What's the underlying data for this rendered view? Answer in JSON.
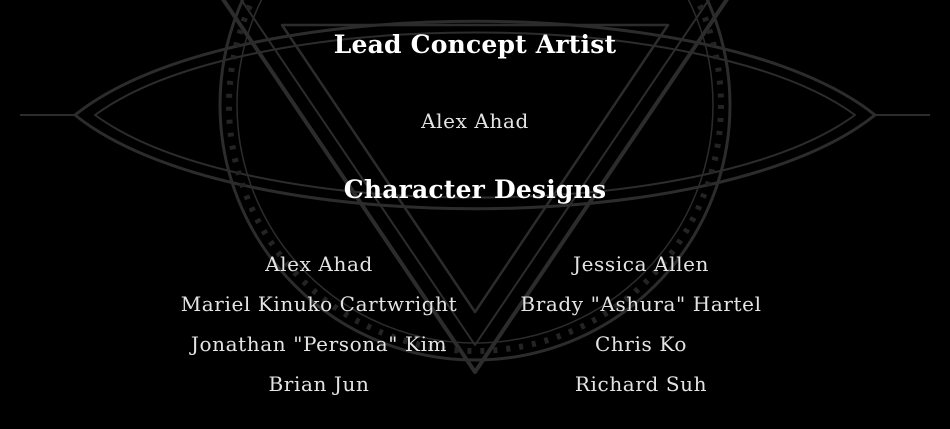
{
  "credits": {
    "lead_concept": {
      "title": "Lead Concept Artist",
      "names": [
        "Alex Ahad"
      ]
    },
    "character_designs": {
      "title": "Character Designs",
      "left_column": [
        "Alex Ahad",
        "Mariel Kinuko Cartwright",
        "Jonathan \"Persona\" Kim",
        "Brian Jun"
      ],
      "right_column": [
        "Jessica Allen",
        "Brady \"Ashura\" Hartel",
        "Chris Ko",
        "Richard Suh"
      ]
    }
  },
  "colors": {
    "background": "#000000",
    "heading": "#ffffff",
    "name": "#e4e4e4",
    "emblem": "#2e2e2e"
  },
  "background_emblem": "inverted-triangle-eye-emblem"
}
